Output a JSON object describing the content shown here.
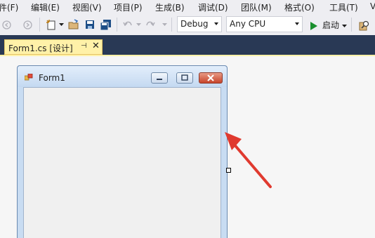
{
  "menu": {
    "items": [
      "件(F)",
      "编辑(E)",
      "视图(V)",
      "项目(P)",
      "生成(B)",
      "调试(D)",
      "团队(M)",
      "格式(O)",
      "工具(T)",
      "V"
    ]
  },
  "toolbar": {
    "config_value": "Debug",
    "platform_value": "Any CPU",
    "start_label": "启动"
  },
  "document_tab": {
    "label": "Form1.cs [设计]",
    "pin_glyph": "⊣",
    "close_glyph": "✕"
  },
  "form": {
    "title": "Form1",
    "minimize_glyph": "—",
    "maximize_glyph": "□",
    "close_glyph": "✕"
  },
  "colors": {
    "dock": "#293955",
    "tab_active": "#fff1a8",
    "arrow": "#e03a2f",
    "start_green": "#1a8f2e"
  }
}
